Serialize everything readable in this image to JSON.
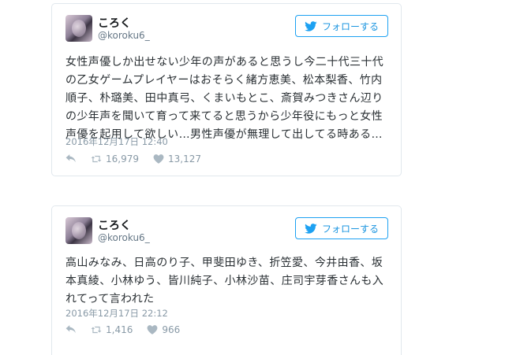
{
  "tweets": [
    {
      "display_name": "ころく",
      "handle": "@koroku6_",
      "follow_label": "フォローする",
      "text": "女性声優しか出せない少年の声があると思うし今二十代三十代\nの乙女ゲームプレイヤーはおそらく緒方恵美、松本梨香、竹内\n順子、朴璐美、田中真弓、くまいもとこ、斎賀みつきさん辺り\nの少年声を聞いて育って来てると思うから少年役にもっと女性\n声優を起用して欲しい…男性声優が無理して出してる時ある…",
      "timestamp": "2016年12月17日 12:40",
      "retweets": "16,979",
      "likes": "13,127"
    },
    {
      "display_name": "ころく",
      "handle": "@koroku6_",
      "follow_label": "フォローする",
      "text": "高山みなみ、日高のり子、甲斐田ゆき、折笠愛、今井由香、坂\n本真綾、小林ゆう、皆川純子、小林沙苗、庄司宇芽香さんも入\nれてって言われた",
      "timestamp": "2016年12月17日 22:12",
      "retweets": "1,416",
      "likes": "966"
    }
  ],
  "colors": {
    "accent": "#1da1f2",
    "muted": "#8899a6",
    "border": "#e1e8ed"
  },
  "icons": [
    "twitter-bird-icon",
    "reply-icon",
    "retweet-icon",
    "heart-icon"
  ]
}
